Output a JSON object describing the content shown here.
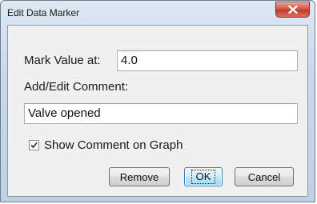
{
  "window": {
    "title": "Edit Data Marker",
    "close_glyph": "x"
  },
  "form": {
    "mark_value_label": "Mark Value at:",
    "mark_value": "4.0",
    "comment_label": "Add/Edit Comment:",
    "comment_value": "Valve opened",
    "show_comment_label": "Show Comment on Graph",
    "show_comment_checked": true
  },
  "buttons": {
    "remove_label": "Remove",
    "ok_label": "OK",
    "cancel_label": "Cancel"
  },
  "colors": {
    "close_button": "#c0392b",
    "default_button_border": "#3c7fb1"
  }
}
